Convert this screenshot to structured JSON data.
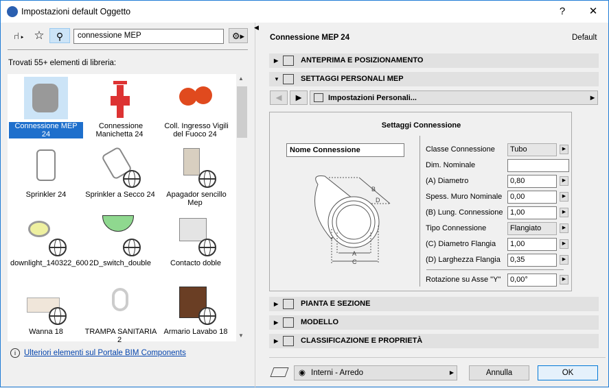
{
  "window": {
    "title": "Impostazioni default Oggetto",
    "help": "?",
    "close": "✕"
  },
  "left": {
    "search_value": "connessione MEP",
    "found_text": "Trovati 55+ elementi di libreria:",
    "items": [
      {
        "label": "Connessione MEP 24"
      },
      {
        "label": "Connessione Manichetta 24"
      },
      {
        "label": "Coll. Ingresso Vigili del Fuoco 24"
      },
      {
        "label": "Sprinkler 24"
      },
      {
        "label": "Sprinkler a Secco 24"
      },
      {
        "label": "Apagador sencillo Mep"
      },
      {
        "label": "downlight_140322_600"
      },
      {
        "label": "2D_switch_double"
      },
      {
        "label": "Contacto doble"
      },
      {
        "label": "Wanna 18"
      },
      {
        "label": "TRAMPA SANITARIA 2"
      },
      {
        "label": "Armario Lavabo 18"
      }
    ],
    "portal_link": "Ulteriori elementi sul Portale BIM Components"
  },
  "right": {
    "object_name": "Connessione MEP 24",
    "default_label": "Default",
    "sections": {
      "preview": "ANTEPRIMA E POSIZIONAMENTO",
      "custom": "SETTAGGI PERSONALI MEP",
      "plan": "PIANTA E SEZIONE",
      "model": "MODELLO",
      "class": "CLASSIFICAZIONE E PROPRIETÀ"
    },
    "page_select": "Impostazioni Personali...",
    "panel": {
      "title": "Settaggi Connessione",
      "name_field": "Nome Connessione",
      "diagram_labels": {
        "a": "A",
        "b": "B",
        "c": "C",
        "d": "D"
      },
      "params": [
        {
          "label": "Classe Connessione",
          "value": "Tubo"
        },
        {
          "label": "Dim. Nominale",
          "value": ""
        },
        {
          "label": "(A) Diametro",
          "value": "0,80"
        },
        {
          "label": "Spess. Muro Nominale",
          "value": "0,00"
        },
        {
          "label": "(B) Lung. Connessione",
          "value": "1,00"
        },
        {
          "label": "Tipo Connessione",
          "value": "Flangiato"
        },
        {
          "label": "(C) Diametro Flangia",
          "value": "1,00"
        },
        {
          "label": "(D) Larghezza Flangia",
          "value": "0,35"
        },
        {
          "label": "Rotazione su Asse \"Y\"",
          "value": "0,00°"
        }
      ]
    }
  },
  "footer": {
    "layer": "Interni - Arredo",
    "cancel": "Annulla",
    "ok": "OK"
  }
}
